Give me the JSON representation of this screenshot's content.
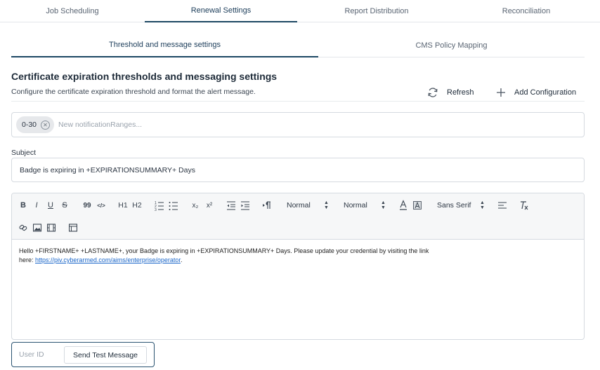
{
  "top_tabs": [
    {
      "label": "Job Scheduling",
      "active": false
    },
    {
      "label": "Renewal Settings",
      "active": true
    },
    {
      "label": "Report Distribution",
      "active": false
    },
    {
      "label": "Reconciliation",
      "active": false
    }
  ],
  "sub_tabs": [
    {
      "label": "Threshold and message settings",
      "active": true
    },
    {
      "label": "CMS Policy Mapping",
      "active": false
    }
  ],
  "section": {
    "title": "Certificate expiration thresholds and messaging settings",
    "description": "Configure the certificate expiration threshold and format the alert message.",
    "refresh_label": "Refresh",
    "add_label": "Add Configuration"
  },
  "notification_ranges": {
    "chips": [
      "0-30"
    ],
    "placeholder": "New notificationRanges..."
  },
  "subject": {
    "label": "Subject",
    "value": "Badge is expiring in +EXPIRATIONSUMMARY+ Days"
  },
  "toolbar": {
    "bold": "B",
    "italic": "I",
    "underline": "U",
    "strike": "S",
    "blockquote": "99",
    "code": "</>",
    "h1": "H1",
    "h2": "H2",
    "subscript": "x₂",
    "superscript": "x²",
    "size_select": "Normal",
    "header_select": "Normal",
    "font_select": "Sans Serif"
  },
  "editor": {
    "body_line1": "Hello +FIRSTNAME+ +LASTNAME+, your Badge is expiring in +EXPIRATIONSUMMARY+ Days. Please update your credential by visiting the link",
    "body_line2_prefix": "here: ",
    "link_text": "https://piv.cyberarmed.com/aims/enterprise/operator",
    "body_line2_suffix": "."
  },
  "test_message": {
    "user_id_placeholder": "User ID",
    "send_label": "Send Test Message"
  },
  "colors": {
    "accent": "#1c4763",
    "link": "#1a66c9",
    "border": "#d5dae0"
  }
}
